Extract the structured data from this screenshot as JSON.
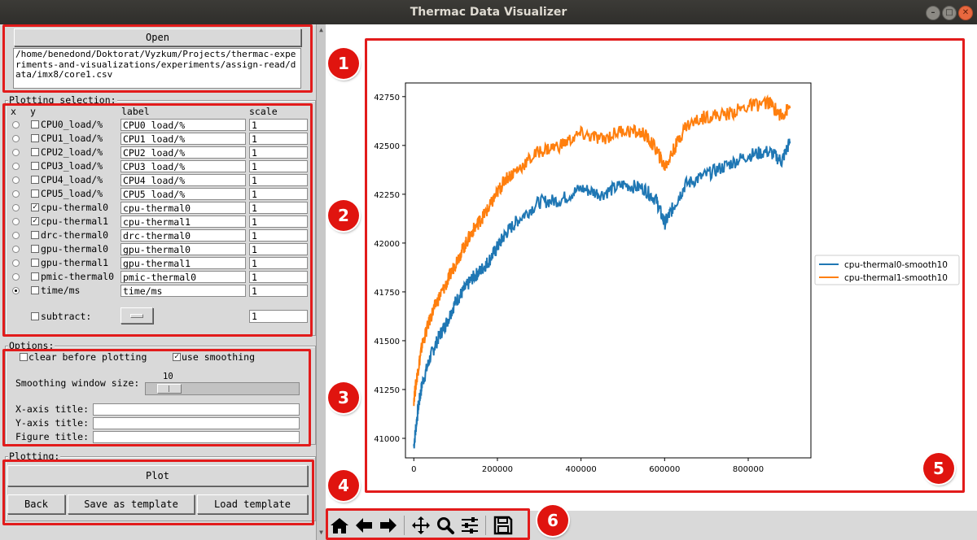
{
  "window": {
    "title": "Thermac Data Visualizer"
  },
  "file": {
    "open_label": "Open",
    "path": "/home/benedond/Doktorat/Vyzkum/Projects/thermac-experiments-and-visualizations/experiments/assign-read/data/imx8/core1.csv"
  },
  "plotting_selection": {
    "title": "Plotting selection:",
    "headers": {
      "x": "x",
      "y": "y",
      "label": "label",
      "scale": "scale"
    },
    "rows": [
      {
        "name": "CPU0_load/%",
        "label": "CPU0_load/%",
        "scale": "1",
        "x": false,
        "y": false
      },
      {
        "name": "CPU1_load/%",
        "label": "CPU1_load/%",
        "scale": "1",
        "x": false,
        "y": false
      },
      {
        "name": "CPU2_load/%",
        "label": "CPU2_load/%",
        "scale": "1",
        "x": false,
        "y": false
      },
      {
        "name": "CPU3_load/%",
        "label": "CPU3_load/%",
        "scale": "1",
        "x": false,
        "y": false
      },
      {
        "name": "CPU4_load/%",
        "label": "CPU4_load/%",
        "scale": "1",
        "x": false,
        "y": false
      },
      {
        "name": "CPU5_load/%",
        "label": "CPU5_load/%",
        "scale": "1",
        "x": false,
        "y": false
      },
      {
        "name": "cpu-thermal0",
        "label": "cpu-thermal0",
        "scale": "1",
        "x": false,
        "y": true
      },
      {
        "name": "cpu-thermal1",
        "label": "cpu-thermal1",
        "scale": "1",
        "x": false,
        "y": true
      },
      {
        "name": "drc-thermal0",
        "label": "drc-thermal0",
        "scale": "1",
        "x": false,
        "y": false
      },
      {
        "name": "gpu-thermal0",
        "label": "gpu-thermal0",
        "scale": "1",
        "x": false,
        "y": false
      },
      {
        "name": "gpu-thermal1",
        "label": "gpu-thermal1",
        "scale": "1",
        "x": false,
        "y": false
      },
      {
        "name": "pmic-thermal0",
        "label": "pmic-thermal0",
        "scale": "1",
        "x": false,
        "y": false
      },
      {
        "name": "time/ms",
        "label": "time/ms",
        "scale": "1",
        "x": true,
        "y": false
      }
    ],
    "subtract_label": "subtract:",
    "subtract_scale": "1"
  },
  "options": {
    "title": "Options:",
    "clear_label": "clear before plotting",
    "clear_checked": false,
    "smooth_label": "use smoothing",
    "smooth_checked": true,
    "window_label": "Smoothing window size:",
    "window_value": "10",
    "xaxis_label": "X-axis title:",
    "xaxis_value": "",
    "yaxis_label": "Y-axis title:",
    "yaxis_value": "",
    "fig_label": "Figure title:",
    "fig_value": ""
  },
  "plotting": {
    "title": "Plotting:",
    "plot_label": "Plot",
    "back_label": "Back",
    "save_template_label": "Save as template",
    "load_template_label": "Load template"
  },
  "annotations": [
    "1",
    "2",
    "3",
    "4",
    "5",
    "6"
  ],
  "toolbar": {
    "icons": [
      "home-icon",
      "back-arrow-icon",
      "forward-arrow-icon",
      "pan-icon",
      "zoom-icon",
      "configure-subplots-icon",
      "save-icon"
    ]
  },
  "colors": {
    "annotation": "#e21b1b",
    "series1": "#1f77b4",
    "series2": "#ff7f0e"
  },
  "chart_data": {
    "type": "line",
    "title": "",
    "xlabel": "",
    "ylabel": "",
    "xlim": [
      -20000,
      950000
    ],
    "ylim": [
      40900,
      42820
    ],
    "xticks": [
      0,
      200000,
      400000,
      600000,
      800000
    ],
    "yticks": [
      41000,
      41250,
      41500,
      41750,
      42000,
      42250,
      42500,
      42750
    ],
    "legend": "right, outside plot",
    "grid": false,
    "series": [
      {
        "name": "cpu-thermal0-smooth10",
        "x": [
          0,
          10000,
          20000,
          40000,
          60000,
          80000,
          100000,
          120000,
          140000,
          160000,
          180000,
          200000,
          220000,
          250000,
          300000,
          350000,
          400000,
          450000,
          500000,
          550000,
          580000,
          600000,
          620000,
          650000,
          700000,
          750000,
          800000,
          850000,
          880000,
          900000
        ],
        "y": [
          40960,
          41150,
          41280,
          41420,
          41520,
          41600,
          41700,
          41760,
          41820,
          41860,
          41910,
          41980,
          42050,
          42120,
          42210,
          42220,
          42280,
          42250,
          42300,
          42280,
          42220,
          42100,
          42180,
          42300,
          42350,
          42400,
          42450,
          42470,
          42420,
          42520
        ]
      },
      {
        "name": "cpu-thermal1-smooth10",
        "x": [
          0,
          10000,
          20000,
          40000,
          60000,
          80000,
          100000,
          120000,
          140000,
          160000,
          180000,
          200000,
          220000,
          250000,
          300000,
          350000,
          400000,
          450000,
          500000,
          550000,
          580000,
          600000,
          620000,
          650000,
          700000,
          750000,
          800000,
          850000,
          880000,
          900000
        ],
        "y": [
          41200,
          41350,
          41480,
          41620,
          41720,
          41800,
          41900,
          41980,
          42060,
          42120,
          42180,
          42260,
          42330,
          42380,
          42470,
          42500,
          42560,
          42530,
          42580,
          42560,
          42480,
          42390,
          42470,
          42600,
          42650,
          42660,
          42700,
          42720,
          42650,
          42700
        ]
      }
    ]
  }
}
